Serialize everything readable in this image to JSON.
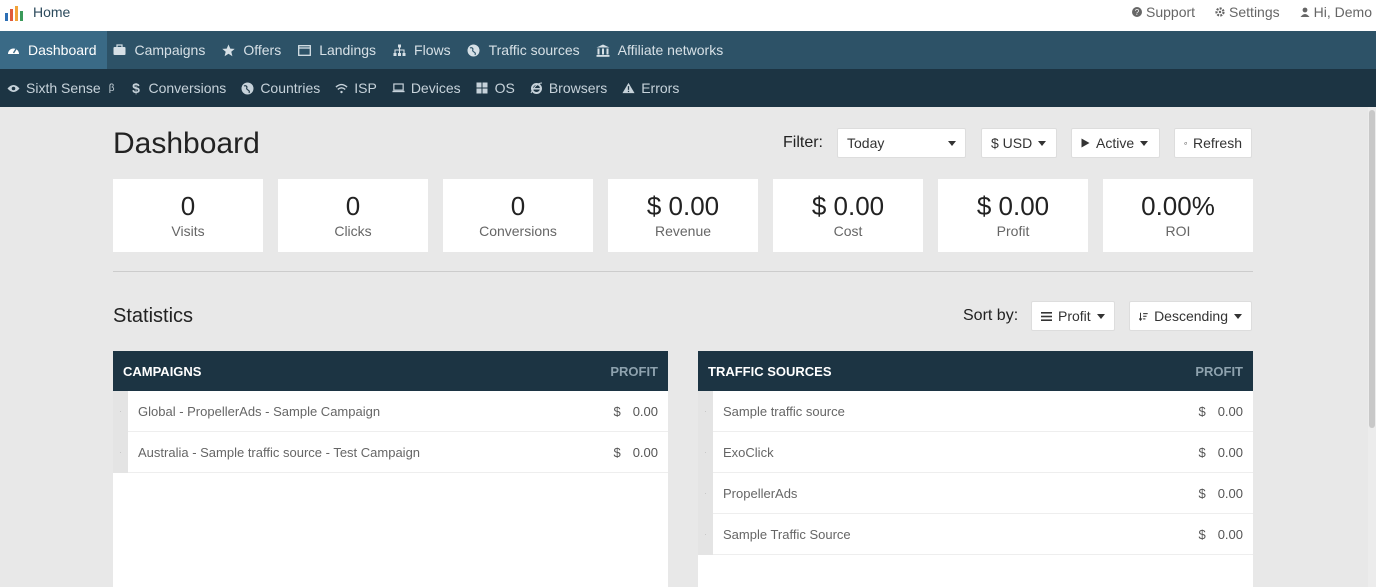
{
  "topbar": {
    "home_label": "Home",
    "support_label": "Support",
    "settings_label": "Settings",
    "user_label": "Hi, Demo"
  },
  "nav_primary": [
    {
      "label": "Dashboard",
      "icon": "dashboard-icon",
      "active": true
    },
    {
      "label": "Campaigns",
      "icon": "briefcase-icon"
    },
    {
      "label": "Offers",
      "icon": "star-icon"
    },
    {
      "label": "Landings",
      "icon": "window-icon"
    },
    {
      "label": "Flows",
      "icon": "sitemap-icon"
    },
    {
      "label": "Traffic sources",
      "icon": "globe-icon"
    },
    {
      "label": "Affiliate networks",
      "icon": "bank-icon"
    }
  ],
  "nav_secondary": [
    {
      "label": "Sixth Sense",
      "sup": "β",
      "icon": "eye-icon"
    },
    {
      "label": "Conversions",
      "icon": "dollar-icon"
    },
    {
      "label": "Countries",
      "icon": "globe-icon"
    },
    {
      "label": "ISP",
      "icon": "wifi-icon"
    },
    {
      "label": "Devices",
      "icon": "laptop-icon"
    },
    {
      "label": "OS",
      "icon": "windows-icon"
    },
    {
      "label": "Browsers",
      "icon": "ie-icon"
    },
    {
      "label": "Errors",
      "icon": "warning-icon"
    }
  ],
  "page": {
    "title": "Dashboard",
    "filter_label": "Filter:",
    "filter_value": "Today",
    "currency_value": "$ USD",
    "status_value": "Active",
    "refresh_label": "Refresh"
  },
  "cards": [
    {
      "value": "0",
      "label": "Visits"
    },
    {
      "value": "0",
      "label": "Clicks"
    },
    {
      "value": "0",
      "label": "Conversions"
    },
    {
      "value": "$ 0.00",
      "label": "Revenue"
    },
    {
      "value": "$ 0.00",
      "label": "Cost"
    },
    {
      "value": "$ 0.00",
      "label": "Profit"
    },
    {
      "value": "0.00%",
      "label": "ROI"
    }
  ],
  "statistics": {
    "title": "Statistics",
    "sort_label": "Sort by:",
    "sort_value": "Profit",
    "order_value": "Descending"
  },
  "campaigns_panel": {
    "title": "CAMPAIGNS",
    "column": "PROFIT",
    "rows": [
      {
        "name": "Global - PropellerAds - Sample Campaign",
        "currency": "$",
        "value": "0.00"
      },
      {
        "name": "Australia - Sample traffic source - Test Campaign",
        "currency": "$",
        "value": "0.00"
      }
    ]
  },
  "traffic_panel": {
    "title": "TRAFFIC SOURCES",
    "column": "PROFIT",
    "rows": [
      {
        "name": "Sample traffic source",
        "currency": "$",
        "value": "0.00"
      },
      {
        "name": "ExoClick",
        "currency": "$",
        "value": "0.00"
      },
      {
        "name": "PropellerAds",
        "currency": "$",
        "value": "0.00"
      },
      {
        "name": "Sample Traffic Source",
        "currency": "$",
        "value": "0.00"
      }
    ]
  },
  "colors": {
    "nav_primary": "#2d5267",
    "nav_active": "#3a6a86",
    "nav_secondary": "#1c3443",
    "background": "#e8e8e8"
  }
}
